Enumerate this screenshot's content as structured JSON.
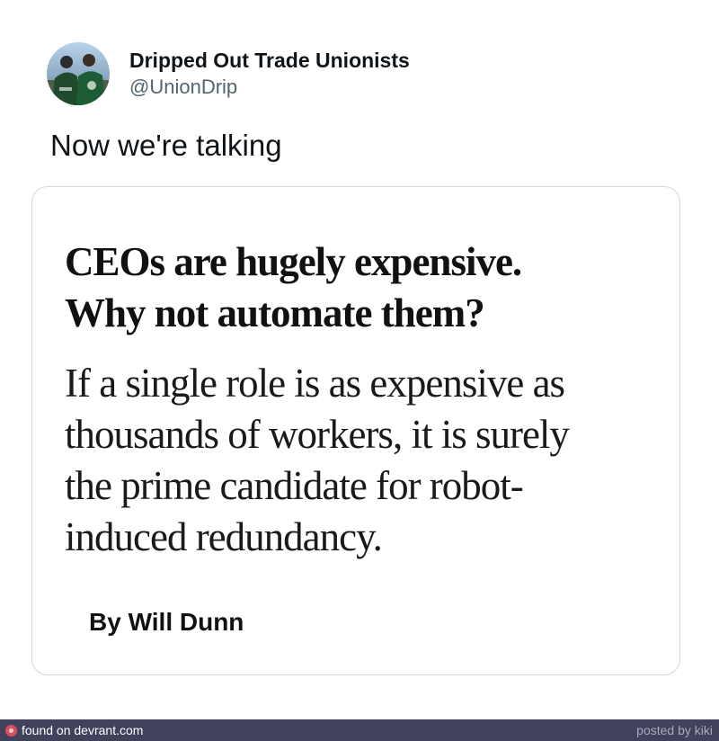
{
  "tweet": {
    "author": {
      "display_name": "Dripped Out Trade Unionists",
      "handle": "@UnionDrip",
      "avatar_icon": "profile-photo"
    },
    "text": "Now we're talking"
  },
  "article_card": {
    "headline_line1": "CEOs are hugely expensive.",
    "headline_line2": "Why not automate them?",
    "standfirst_line1": "If a single role is as expensive as",
    "standfirst_line2": "thousands of workers, it is surely",
    "standfirst_line3": "the prime candidate for robot-",
    "standfirst_line4": "induced redundancy.",
    "byline": "By Will Dunn"
  },
  "footer": {
    "source_text": "found on devrant.com",
    "posted_by": "posted by kiki",
    "logo_icon": "devrant-logo-icon",
    "bar_color": "#40415a",
    "logo_color": "#d55161"
  }
}
